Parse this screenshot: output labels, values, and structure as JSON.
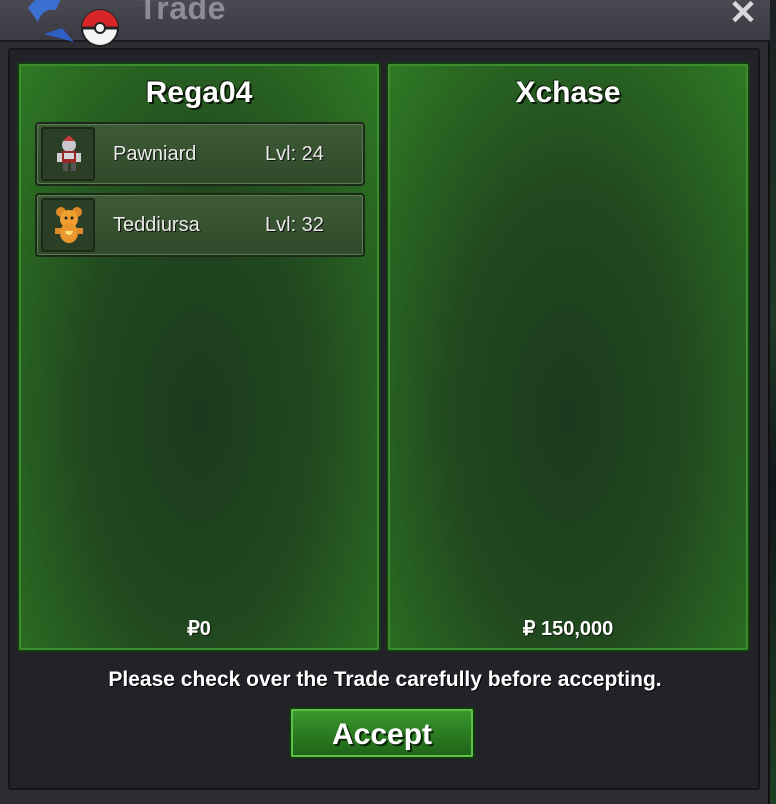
{
  "window": {
    "title": "Trade",
    "close_glyph": "✕"
  },
  "players": [
    {
      "name": "Rega04",
      "money": "₽0",
      "pokemon": [
        {
          "name": "Pawniard",
          "level": "Lvl: 24",
          "icon": "pawniard-sprite-icon"
        },
        {
          "name": "Teddiursa",
          "level": "Lvl: 32",
          "icon": "teddiursa-sprite-icon"
        }
      ]
    },
    {
      "name": "Xchase",
      "money": "₽ 150,000",
      "pokemon": []
    }
  ],
  "notice": "Please check over the Trade carefully before accepting.",
  "accept_label": "Accept",
  "colors": {
    "panel_green": "#2f7a24",
    "button_green": "#2a7a20",
    "window_bg": "#2d2c33"
  }
}
